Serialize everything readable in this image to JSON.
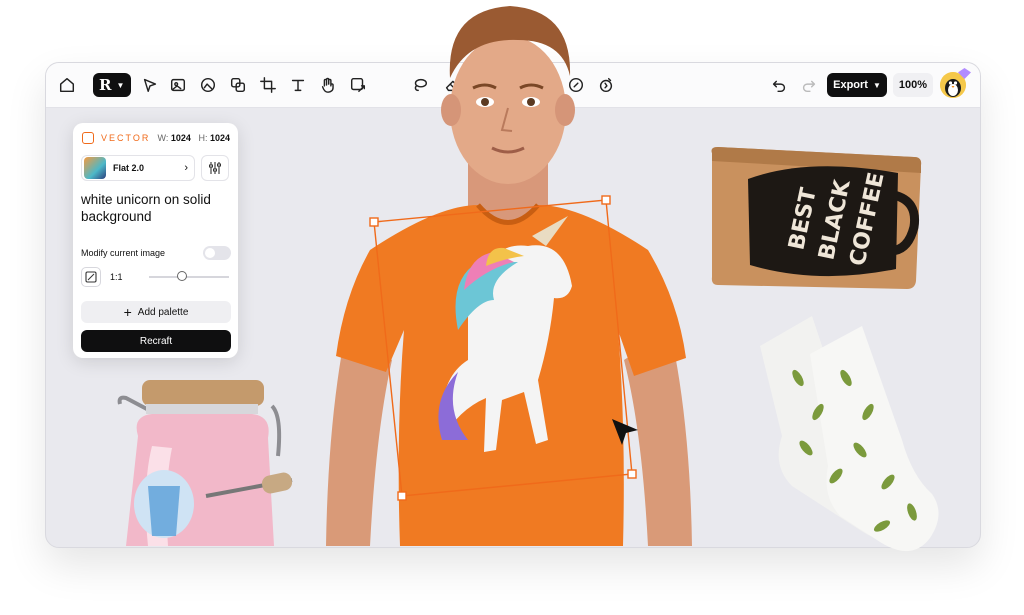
{
  "toolbar": {
    "export_label": "Export",
    "zoom_label": "100%",
    "tools": [
      "home-icon",
      "pointer-icon",
      "frame-icon",
      "image-icon",
      "layers-icon",
      "crop-icon",
      "text-icon",
      "hand-icon",
      "upload-icon",
      "lasso-icon",
      "eraser-icon",
      "compass-icon",
      "wand-icon",
      "undo-icon",
      "redo-icon"
    ]
  },
  "panel": {
    "type_label": "VECTOR",
    "width_label": "W:",
    "width_value": "1024",
    "height_label": "H:",
    "height_value": "1024",
    "style_name": "Flat 2.0",
    "prompt": "white unicorn on solid background",
    "modify_label": "Modify current image",
    "modify_enabled": false,
    "ratio_label": "1:1",
    "add_palette_label": "Add palette",
    "recraft_label": "Recraft"
  },
  "canvas": {
    "coffee_bag_text": [
      "BEST",
      "BLACK",
      "COFFEE"
    ]
  },
  "colors": {
    "accent": "#f06a1a",
    "shirt": "#f07a22",
    "canvas_bg": "#e9e9ee",
    "dark_button": "#0f0f10"
  }
}
